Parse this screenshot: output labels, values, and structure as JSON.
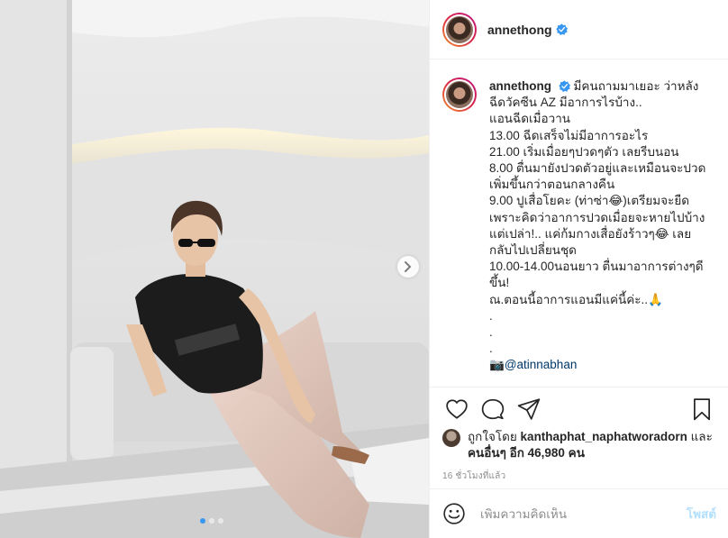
{
  "header": {
    "username": "annethong"
  },
  "caption": {
    "username": "annethong",
    "lines": [
      "มีคนถามมาเยอะ ว่าหลัง",
      "ฉีดวัคซีน AZ มีอาการไรบ้าง..",
      "แอนฉีดเมื่อวาน",
      "13.00 ฉีดเสร็จไม่มีอาการอะไร",
      "21.00 เริ่มเมื่อยๆปวดๆตัว เลยรีบนอน",
      "8.00 ตื่นมายังปวดตัวอยู่และเหมือนจะปวด",
      "เพิ่มขึ้นกว่าตอนกลางคืน",
      "9.00 ปูเสื่อโยคะ (ท่าซ่า😂)เตรียมจะยืด",
      "เพราะคิดว่าอาการปวดเมื่อยจะหายไปบ้าง",
      "แต่เปล่า!.. แค่ก้มกางเสื่อยังร้าวๆ😂 เลย",
      "กลับไปเปลี่ยนชุด",
      "10.00-14.00นอนยาว ตื่นมาอาการต่างๆดี",
      "ขึ้น!",
      "ณ.ตอนนี้อาการแอนมีแค่นี้ค่ะ..🙏",
      ".",
      ".",
      "."
    ],
    "camera_icon": "📷",
    "mention": "@atinnabhan"
  },
  "likes": {
    "prefix": "ถูกใจโดย",
    "liker": "kanthaphat_naphatworadorn",
    "and": "และ",
    "others": "คนอื่นๆ อีก 46,980 คน"
  },
  "timestamp": "16 ชั่วโมงที่แล้ว",
  "comment": {
    "placeholder": "เพิ่มความคิดเห็น",
    "post_label": "โพสต์"
  },
  "colors": {
    "verified": "#3897f0",
    "link": "#00376b",
    "post_disabled": "#b2dffc"
  },
  "carousel": {
    "slide_count": 3,
    "current": 1
  }
}
